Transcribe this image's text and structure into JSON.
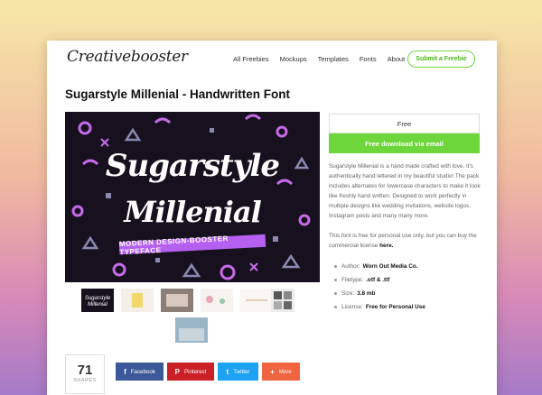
{
  "site": {
    "logo": "Creativebooster"
  },
  "nav": {
    "items": [
      "All Freebies",
      "Mockups",
      "Templates",
      "Fonts",
      "About"
    ],
    "submit_label": "Submit a Freebie"
  },
  "page": {
    "title": "Sugarstyle Millenial - Handwritten Font"
  },
  "hero": {
    "line1": "Sugarstyle",
    "line2": "Millenial",
    "banner": "MODERN DESIGN-BOOSTER TYPEFACE"
  },
  "sidebar": {
    "price": "Free",
    "download_label": "Free download via email",
    "description": "Sugarstyle Millenial is a hand made crafted with love. It's authentically hand lettered in my beautiful studio! The pack includes alternates for lowercase characters to make it look like freshly hand written. Designed to work perfectly in multiple designs like wedding invitations, website logos, Instagram posts and many many more.",
    "license_text": "This font is free for personal use only, but you can buy the commercial license",
    "license_link": "here.",
    "meta": [
      {
        "label": "Author:",
        "value": "Worn Out Media Co."
      },
      {
        "label": "Filetype:",
        "value": ".otf & .ttf"
      },
      {
        "label": "Size:",
        "value": "3.8 mb"
      },
      {
        "label": "License:",
        "value": "Free for Personal Use"
      }
    ]
  },
  "share": {
    "count": "71",
    "count_label": "SHARES",
    "buttons": [
      {
        "label": "Facebook",
        "icon": "facebook-icon",
        "color": "#3b5998"
      },
      {
        "label": "Pinterest",
        "icon": "pinterest-icon",
        "color": "#cb2027"
      },
      {
        "label": "Twitter",
        "icon": "twitter-icon",
        "color": "#1da1f2"
      },
      {
        "label": "More",
        "icon": "plus-icon",
        "color": "#f0653f"
      }
    ]
  },
  "colors": {
    "accent": "#6dd63a",
    "hero_bg": "#17111f",
    "hero_accent": "#b560f0"
  }
}
